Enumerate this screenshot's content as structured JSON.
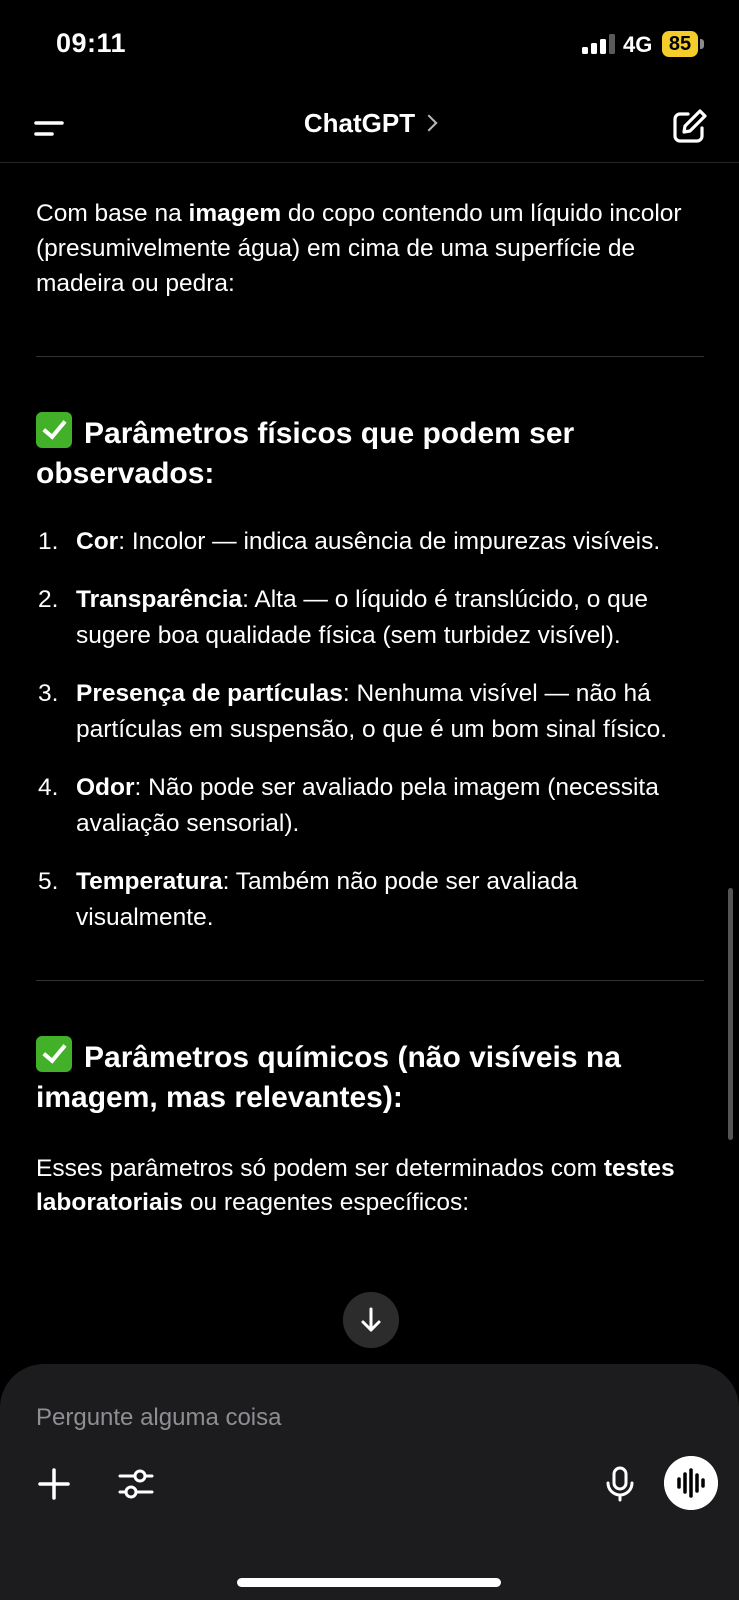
{
  "status_bar": {
    "time": "09:11",
    "network": "4G",
    "battery": "85"
  },
  "header": {
    "title": "ChatGPT"
  },
  "message": {
    "intro": {
      "pre": "Com base na ",
      "bold": "imagem",
      "post": " do copo contendo um líquido incolor (presumivelmente água) em cima de uma superfície de madeira ou pedra:"
    },
    "section1": {
      "heading": "Parâmetros físicos que podem ser observados:",
      "items": [
        {
          "num": "1.",
          "term": "Cor",
          "text": ": Incolor — indica ausência de impurezas visíveis."
        },
        {
          "num": "2.",
          "term": "Transparência",
          "text": ": Alta — o líquido é translúcido, o que sugere boa qualidade física (sem turbidez visível)."
        },
        {
          "num": "3.",
          "term": "Presença de partículas",
          "text": ": Nenhuma visível — não há partículas em suspensão, o que é um bom sinal físico."
        },
        {
          "num": "4.",
          "term": "Odor",
          "text": ": Não pode ser avaliado pela imagem (necessita avaliação sensorial)."
        },
        {
          "num": "5.",
          "term": "Temperatura",
          "text": ": Também não pode ser avaliada visualmente."
        }
      ]
    },
    "section2": {
      "heading": "Parâmetros químicos (não visíveis na imagem, mas relevantes):",
      "para_pre": "Esses parâmetros só podem ser determinados com ",
      "para_bold": "testes laboratoriais",
      "para_post": " ou reagentes específicos:"
    }
  },
  "composer": {
    "placeholder": "Pergunte alguma coisa"
  },
  "icons": {
    "menu": "menu-icon",
    "chevron": "chevron-right-icon",
    "edit": "new-chat-icon",
    "check": "check-mark-emoji-icon",
    "scroll_down": "arrow-down-icon",
    "plus": "plus-icon",
    "tools": "sliders-icon",
    "mic": "microphone-icon",
    "voice": "voice-wave-icon"
  },
  "colors": {
    "background": "#000000",
    "composer": "#1c1c1e",
    "battery": "#f4cd2a",
    "check": "#43b02a"
  }
}
